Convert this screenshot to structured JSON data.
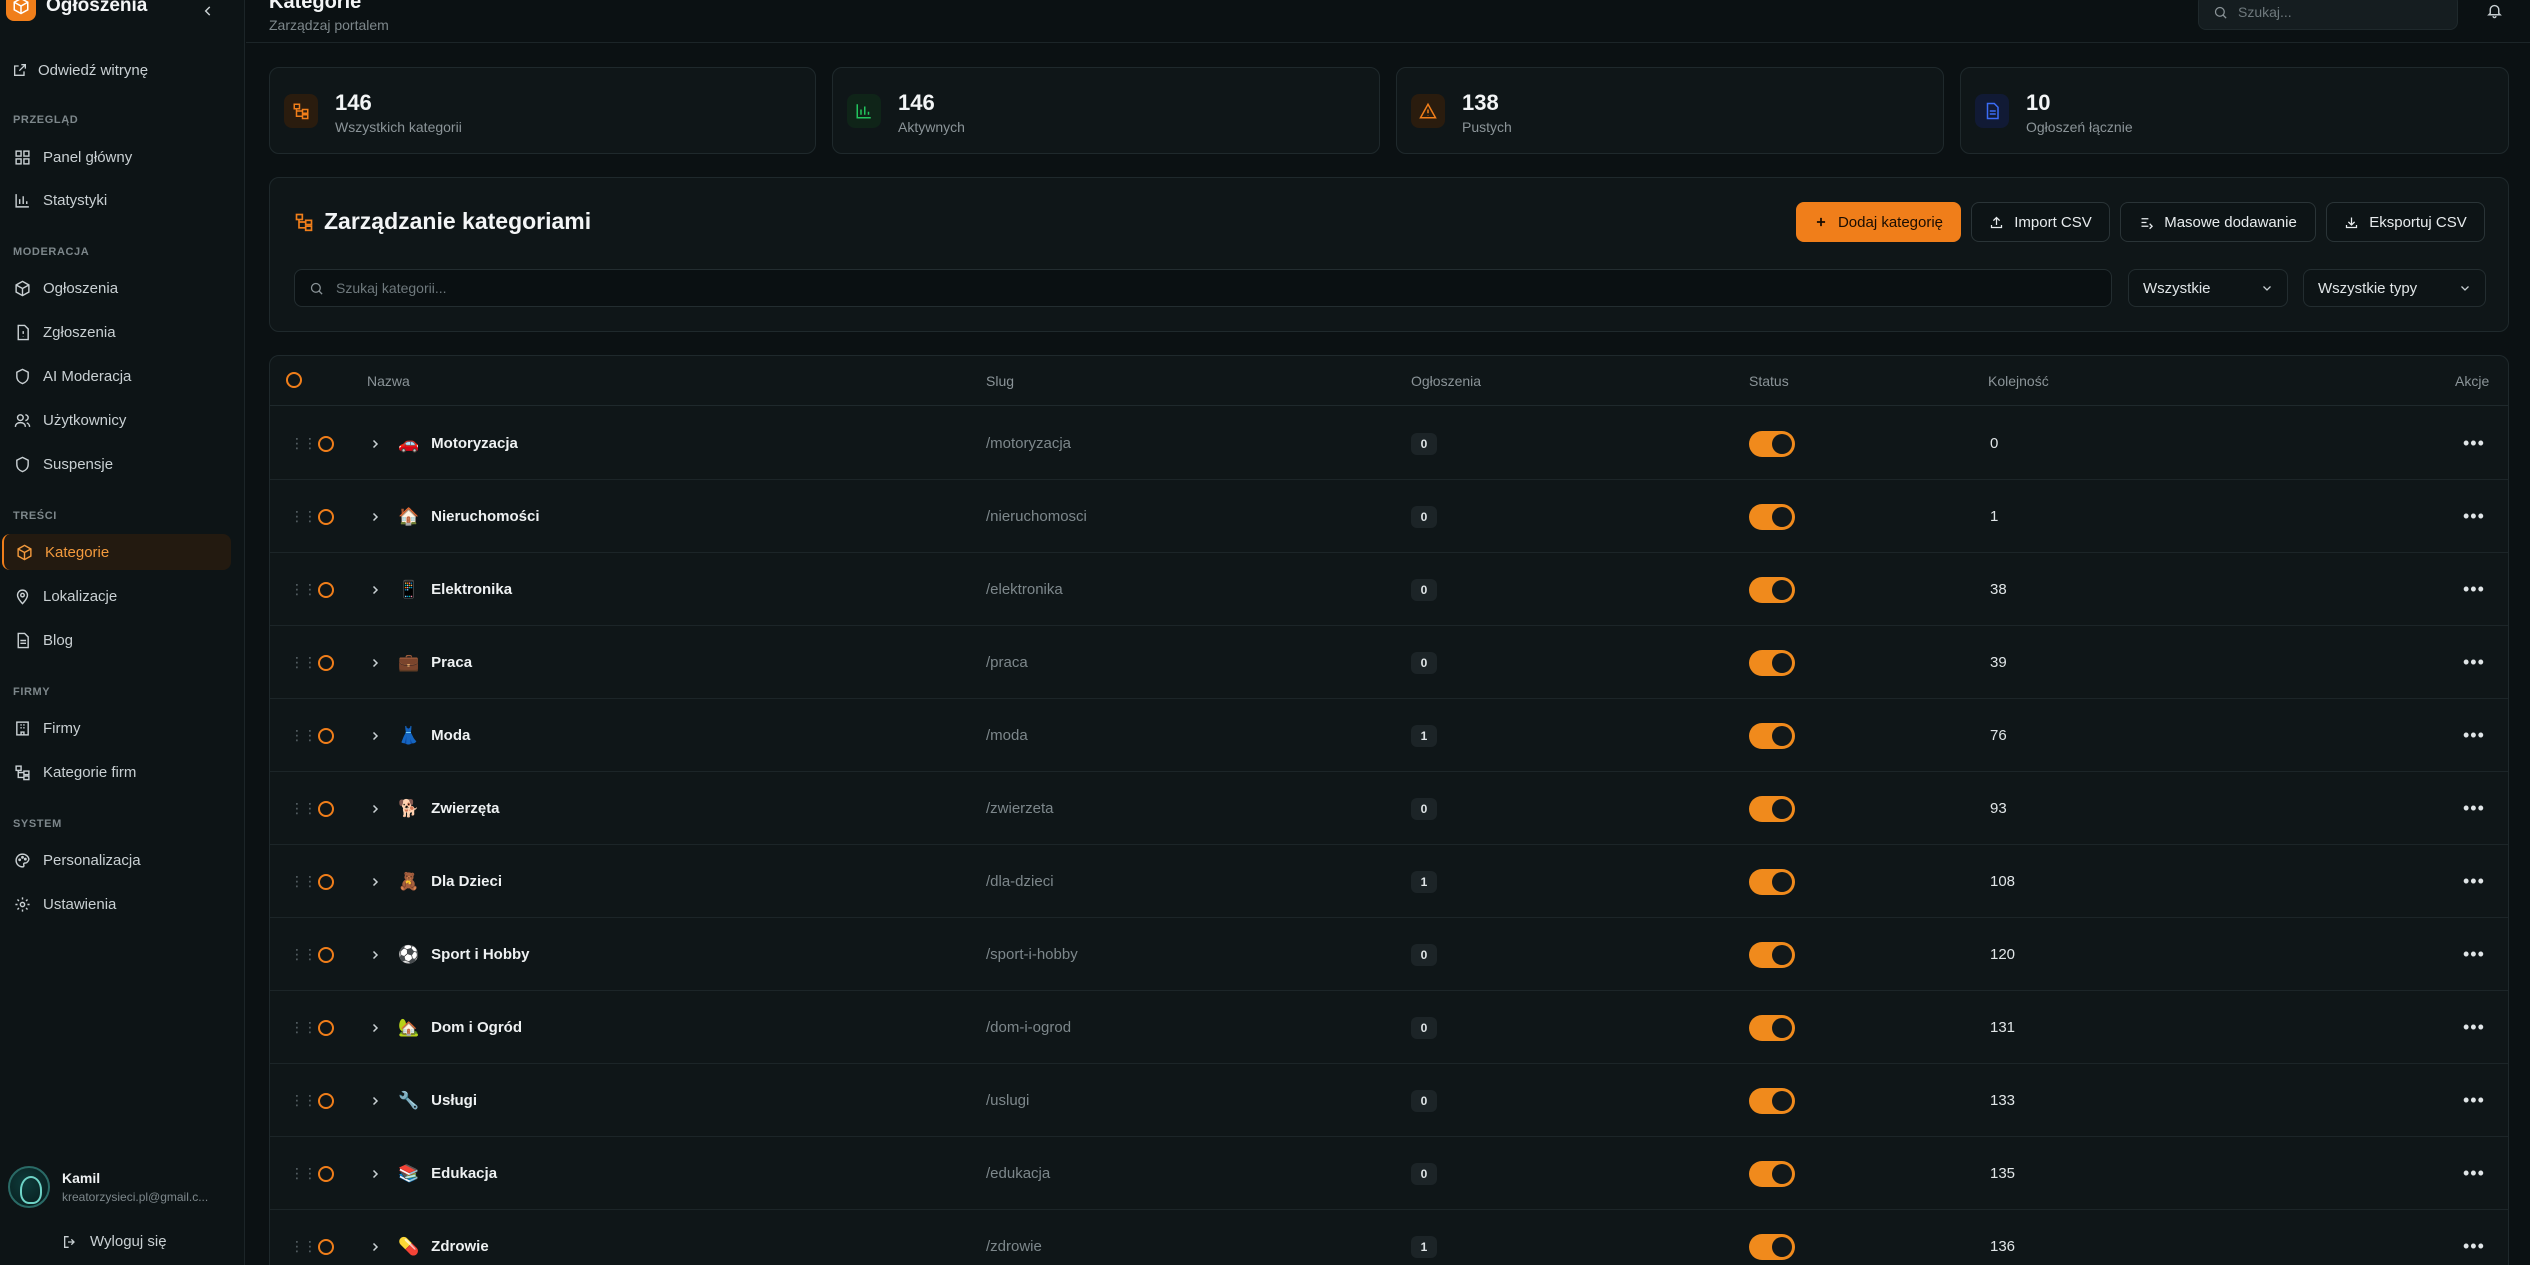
{
  "sidebar": {
    "brand": "Ogłoszenia",
    "visit_site": "Odwiedź witrynę",
    "sections": [
      {
        "label": "PRZEGLĄD",
        "items": [
          {
            "label": "Panel główny",
            "icon": "dashboard-icon"
          },
          {
            "label": "Statystyki",
            "icon": "bar-chart-icon"
          }
        ]
      },
      {
        "label": "MODERACJA",
        "items": [
          {
            "label": "Ogłoszenia",
            "icon": "cube-icon"
          },
          {
            "label": "Zgłoszenia",
            "icon": "report-icon"
          },
          {
            "label": "AI Moderacja",
            "icon": "shield-icon"
          },
          {
            "label": "Użytkownicy",
            "icon": "users-icon"
          },
          {
            "label": "Suspensje",
            "icon": "shield-icon"
          }
        ]
      },
      {
        "label": "TREŚCI",
        "items": [
          {
            "label": "Kategorie",
            "icon": "cube-icon",
            "active": true
          },
          {
            "label": "Lokalizacje",
            "icon": "map-pin-icon"
          },
          {
            "label": "Blog",
            "icon": "document-icon"
          }
        ]
      },
      {
        "label": "FIRMY",
        "items": [
          {
            "label": "Firmy",
            "icon": "building-icon"
          },
          {
            "label": "Kategorie firm",
            "icon": "tree-icon"
          }
        ]
      },
      {
        "label": "SYSTEM",
        "items": [
          {
            "label": "Personalizacja",
            "icon": "palette-icon"
          },
          {
            "label": "Ustawienia",
            "icon": "gear-icon"
          }
        ]
      }
    ],
    "user": {
      "name": "Kamil",
      "email": "kreatorzysieci.pl@gmail.c..."
    },
    "logout": "Wyloguj się"
  },
  "header": {
    "title": "Kategorie",
    "subtitle": "Zarządzaj portalem",
    "search_placeholder": "Szukaj..."
  },
  "stats": [
    {
      "value": "146",
      "label": "Wszystkich kategorii",
      "icon": "tree-icon",
      "color": "#f07e1a"
    },
    {
      "value": "146",
      "label": "Aktywnych",
      "icon": "bar-chart-icon",
      "color": "#22c55e"
    },
    {
      "value": "138",
      "label": "Pustych",
      "icon": "warning-icon",
      "color": "#f07e1a"
    },
    {
      "value": "10",
      "label": "Ogłoszeń łącznie",
      "icon": "document-icon",
      "color": "#3b6cf6"
    }
  ],
  "panel": {
    "title": "Zarządzanie kategoriami",
    "buttons": {
      "add": "Dodaj kategorię",
      "import": "Import CSV",
      "bulk": "Masowe dodawanie",
      "export": "Eksportuj CSV"
    },
    "search_placeholder": "Szukaj kategorii...",
    "filter_status": "Wszystkie",
    "filter_type": "Wszystkie typy"
  },
  "table": {
    "columns": {
      "name": "Nazwa",
      "slug": "Slug",
      "count": "Ogłoszenia",
      "status": "Status",
      "order": "Kolejność",
      "actions": "Akcje"
    },
    "rows": [
      {
        "emoji": "🚗",
        "name": "Motoryzacja",
        "slug": "/motoryzacja",
        "count": "0",
        "order": "0"
      },
      {
        "emoji": "🏠",
        "name": "Nieruchomości",
        "slug": "/nieruchomosci",
        "count": "0",
        "order": "1"
      },
      {
        "emoji": "📱",
        "name": "Elektronika",
        "slug": "/elektronika",
        "count": "0",
        "order": "38"
      },
      {
        "emoji": "💼",
        "name": "Praca",
        "slug": "/praca",
        "count": "0",
        "order": "39"
      },
      {
        "emoji": "👗",
        "name": "Moda",
        "slug": "/moda",
        "count": "1",
        "order": "76"
      },
      {
        "emoji": "🐕",
        "name": "Zwierzęta",
        "slug": "/zwierzeta",
        "count": "0",
        "order": "93"
      },
      {
        "emoji": "🧸",
        "name": "Dla Dzieci",
        "slug": "/dla-dzieci",
        "count": "1",
        "order": "108"
      },
      {
        "emoji": "⚽",
        "name": "Sport i Hobby",
        "slug": "/sport-i-hobby",
        "count": "0",
        "order": "120"
      },
      {
        "emoji": "🏡",
        "name": "Dom i Ogród",
        "slug": "/dom-i-ogrod",
        "count": "0",
        "order": "131"
      },
      {
        "emoji": "🔧",
        "name": "Usługi",
        "slug": "/uslugi",
        "count": "0",
        "order": "133"
      },
      {
        "emoji": "📚",
        "name": "Edukacja",
        "slug": "/edukacja",
        "count": "0",
        "order": "135"
      },
      {
        "emoji": "💊",
        "name": "Zdrowie",
        "slug": "/zdrowie",
        "count": "1",
        "order": "136"
      }
    ]
  },
  "colors": {
    "accent": "#f07e1a",
    "background": "#0b1113",
    "panel": "#0f1618"
  }
}
